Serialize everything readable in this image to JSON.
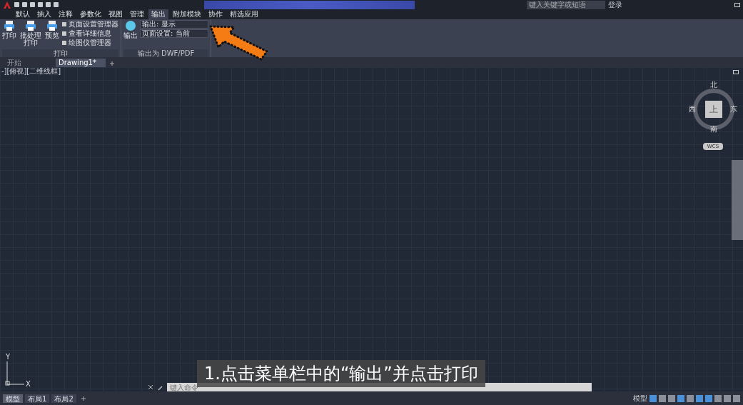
{
  "ribbon_tabs": [
    {
      "label": "默认",
      "selected": false
    },
    {
      "label": "插入",
      "selected": false
    },
    {
      "label": "注释",
      "selected": false
    },
    {
      "label": "参数化",
      "selected": false
    },
    {
      "label": "视图",
      "selected": false
    },
    {
      "label": "管理",
      "selected": false
    },
    {
      "label": "输出",
      "selected": true
    },
    {
      "label": "附加模块",
      "selected": false
    },
    {
      "label": "协作",
      "selected": false
    },
    {
      "label": "精选应用",
      "selected": false
    }
  ],
  "search": {
    "placeholder": "键入关键字或短语"
  },
  "user": "登录",
  "print_panel": {
    "title": "打印",
    "large_buttons": [
      "打印",
      "批处理打印",
      "预览"
    ],
    "small_buttons": [
      "页面设置管理器",
      "查看详细信息",
      "绘图仪管理器"
    ]
  },
  "export_panel": {
    "title": "输出为 DWF/PDF",
    "large_button": "输出",
    "dropdowns": [
      "输出: 显示",
      "页面设置: 当前"
    ]
  },
  "doc_tabs": [
    {
      "label": "开始",
      "selected": false
    },
    {
      "label": "Drawing1*",
      "selected": true
    }
  ],
  "viewport_label": "-][俯视][二维线框]",
  "viewcube": {
    "north": "北",
    "south": "南",
    "east": "东",
    "west": "西",
    "top": "上",
    "ucs": "WCS"
  },
  "axes": {
    "x": "X",
    "y": "Y"
  },
  "command": {
    "placeholder": "键入命令"
  },
  "layout_tabs": [
    {
      "label": "模型",
      "selected": true
    },
    {
      "label": "布局1",
      "selected": false
    },
    {
      "label": "布局2",
      "selected": false
    }
  ],
  "status": {
    "model": "模型"
  },
  "caption": "1.点击菜单栏中的“输出”并点击打印"
}
